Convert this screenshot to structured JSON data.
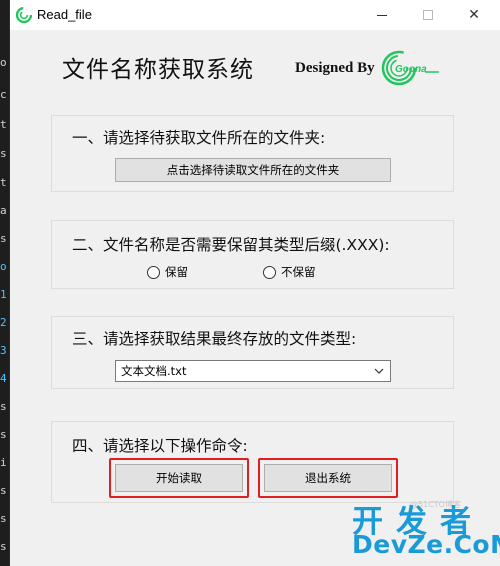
{
  "background": {
    "left_edge_chars": [
      "o",
      "c",
      "t",
      "s",
      "t",
      "a",
      "s",
      "o",
      "1",
      "2",
      "3",
      "4",
      "s",
      "s",
      "i",
      "s",
      "s",
      "s"
    ]
  },
  "window": {
    "title": "Read_file",
    "controls": {
      "close": "✕"
    }
  },
  "header": {
    "title": "文件名称获取系统",
    "designed_by": "Designed By",
    "logo_text": "Goona"
  },
  "step1": {
    "label": "一、请选择待获取文件所在的文件夹:",
    "button": "点击选择待读取文件所在的文件夹"
  },
  "step2": {
    "label": "二、文件名称是否需要保留其类型后缀(.XXX):",
    "options": [
      "保留",
      "不保留"
    ]
  },
  "step3": {
    "label": "三、请选择获取结果最终存放的文件类型:",
    "selected": "文本文档.txt"
  },
  "step4": {
    "label": "四、请选择以下操作命令:",
    "start_button": "开始读取",
    "exit_button": "退出系统"
  },
  "overlay": {
    "watermark": "@51CTO博客",
    "brand_top": "开发者",
    "brand_bottom": "DevZe.CoM"
  },
  "colors": {
    "highlight": "#e02020",
    "brand": "#1a9bd8",
    "logo": "#22c55e"
  }
}
